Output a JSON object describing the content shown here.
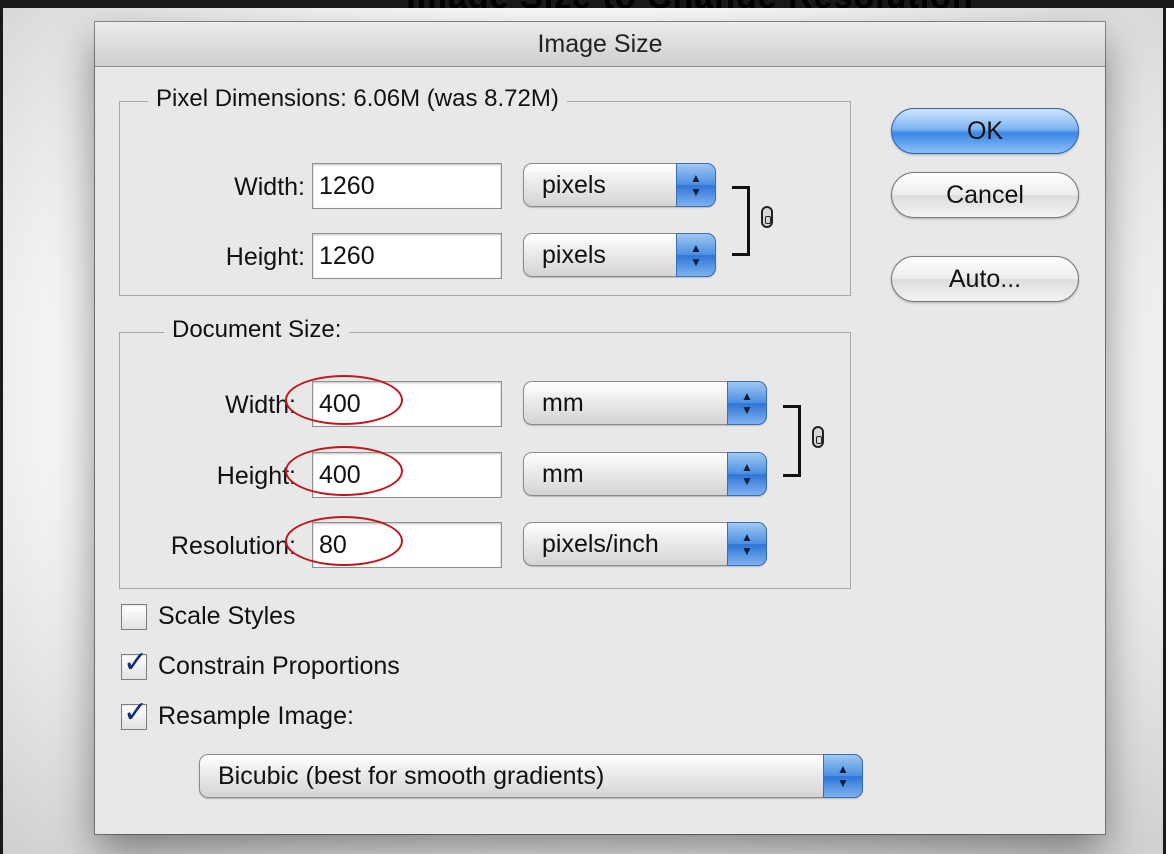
{
  "page": {
    "top_title": "Image Size to Change Resolution"
  },
  "dialog": {
    "title": "Image Size",
    "pixel_dimensions": {
      "legend": "Pixel Dimensions:  6.06M (was 8.72M)",
      "width_label": "Width:",
      "width_value": "1260",
      "width_unit": "pixels",
      "height_label": "Height:",
      "height_value": "1260",
      "height_unit": "pixels"
    },
    "document_size": {
      "legend": "Document Size:",
      "width_label": "Width:",
      "width_value": "400",
      "width_unit": "mm",
      "height_label": "Height:",
      "height_value": "400",
      "height_unit": "mm",
      "resolution_label": "Resolution:",
      "resolution_value": "80",
      "resolution_unit": "pixels/inch"
    },
    "buttons": {
      "ok": "OK",
      "cancel": "Cancel",
      "auto": "Auto..."
    },
    "options": {
      "scale_styles": {
        "label": "Scale Styles",
        "checked": false
      },
      "constrain": {
        "label": "Constrain Proportions",
        "checked": true
      },
      "resample": {
        "label": "Resample Image:",
        "checked": true
      },
      "resample_method": "Bicubic (best for smooth gradients)"
    },
    "icons": {
      "arrows": "popup-arrows-icon",
      "link": "link-icon",
      "check": "checkmark-icon"
    },
    "colors": {
      "default_button": "#3c86e3",
      "annotation": "#c0171f"
    }
  }
}
